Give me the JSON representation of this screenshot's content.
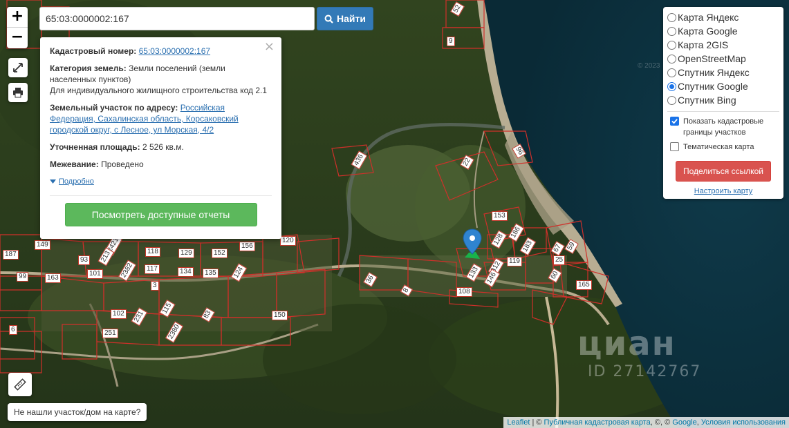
{
  "search": {
    "value": "65:03:0000002:167",
    "button_label": "Найти"
  },
  "popup": {
    "cad_label": "Кадастровый номер:",
    "cad_value": "65:03:0000002:167",
    "cat_label": "Категория земель:",
    "cat_value": "Земли поселений (земли населенных пунктов)",
    "use_value": "Для индивидуального жилищного строительства код 2.1",
    "addr_label": "Земельный участок по адресу:",
    "addr_value": "Российская Федерация, Сахалинская область, Корсаковский городской округ, с Лесное, ул Морская, 4/2",
    "area_label": "Уточненная площадь:",
    "area_value": "2 526 кв.м.",
    "survey_label": "Межевание:",
    "survey_value": "Проведено",
    "more_label": "Подробно",
    "reports_button": "Посмотреть доступные отчеты",
    "close": "×"
  },
  "layers": {
    "options": [
      {
        "label": "Карта Яндекс",
        "selected": false
      },
      {
        "label": "Карта Google",
        "selected": false
      },
      {
        "label": "Карта 2GIS",
        "selected": false
      },
      {
        "label": "OpenStreetMap",
        "selected": false
      },
      {
        "label": "Спутник Яндекс",
        "selected": false
      },
      {
        "label": "Спутник Google",
        "selected": true
      },
      {
        "label": "Спутник Bing",
        "selected": false
      }
    ],
    "show_cadastre_label": "Показать кадастровые границы участков",
    "show_cadastre_checked": true,
    "thematic_label": "Тематическая карта",
    "thematic_checked": false,
    "share_button": "Поделиться ссылкой",
    "configure_link": "Настроить карту"
  },
  "not_found_button": "Не нашли участок/дом на карте?",
  "attribution": {
    "leaflet": "Leaflet",
    "sep1": " | © ",
    "pkk": "Публичная кадастровая карта",
    "sep2": ", ©, © ",
    "google": "Google",
    "sep3": ", ",
    "terms": "Условия использования"
  },
  "watermark": {
    "brand": "циан",
    "id": "ID 27142767",
    "faint": "© 2023"
  },
  "parcels": [
    "52",
    "9",
    "96",
    "22",
    "436",
    "153",
    "186",
    "128",
    "183",
    "59",
    "67",
    "25",
    "60",
    "119",
    "312",
    "146",
    "133",
    "165",
    "108",
    "36",
    "8",
    "120",
    "156",
    "152",
    "129",
    "118",
    "2421",
    "149",
    "187",
    "93",
    "213",
    "2382",
    "117",
    "101",
    "99",
    "163",
    "134",
    "135",
    "124",
    "3",
    "115",
    "102",
    "231",
    "251",
    "2380",
    "83",
    "150",
    "6"
  ],
  "colors": {
    "parcel_border": "#d0302a",
    "search_button": "#337ab7",
    "report_button": "#5cb85c",
    "share_button": "#d9534f",
    "marker": "#2f84d0",
    "selected_parcel": "#19b34a"
  }
}
